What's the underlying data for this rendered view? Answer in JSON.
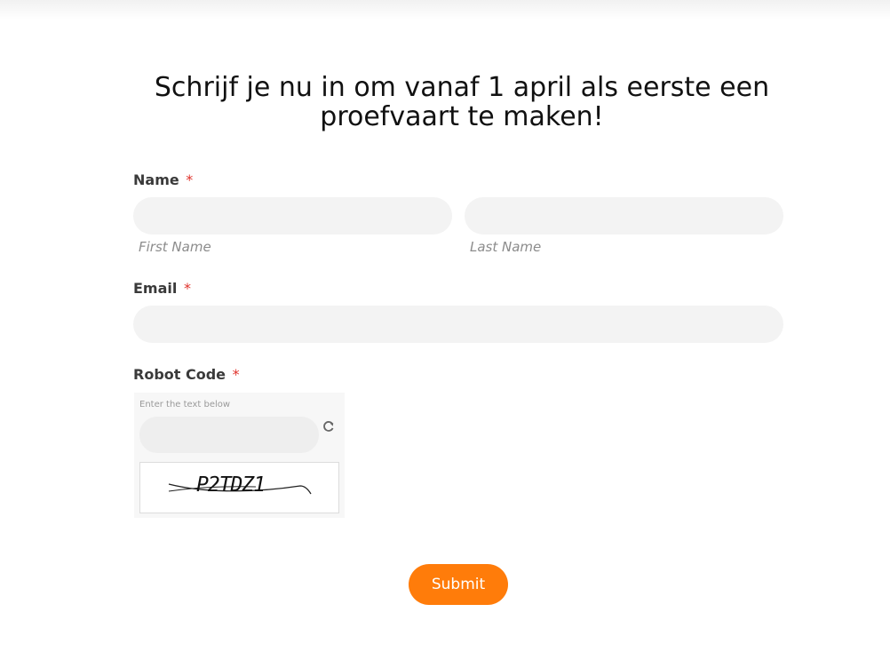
{
  "heading": "Schrijf je nu in om vanaf 1 april als eerste een proefvaart te maken!",
  "form": {
    "name": {
      "label": "Name",
      "required_marker": "*",
      "first_value": "",
      "last_value": "",
      "first_sublabel": "First Name",
      "last_sublabel": "Last Name"
    },
    "email": {
      "label": "Email",
      "required_marker": "*",
      "value": ""
    },
    "robot_code": {
      "label": "Robot Code",
      "required_marker": "*",
      "hint": "Enter the text below",
      "value": "",
      "captcha_text": "P2TDZ1",
      "refresh_icon": "refresh-icon"
    },
    "submit_label": "Submit"
  },
  "colors": {
    "accent": "#ff7c0a",
    "required": "#e0322b",
    "field_bg": "#f3f3f3",
    "label": "#3a3a3a"
  }
}
